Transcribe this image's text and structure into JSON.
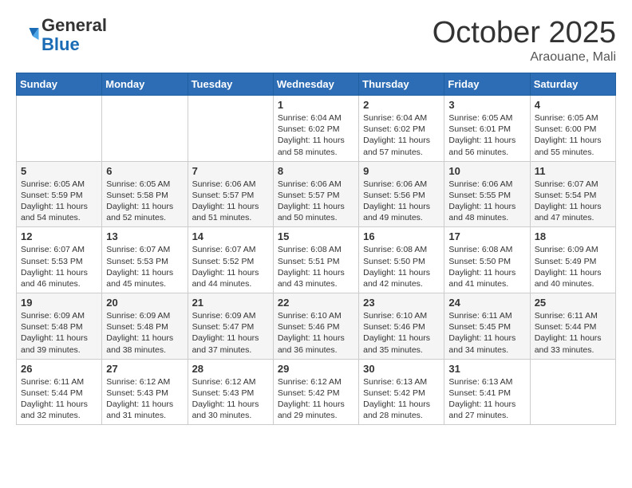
{
  "header": {
    "logo_general": "General",
    "logo_blue": "Blue",
    "month": "October 2025",
    "location": "Araouane, Mali"
  },
  "weekdays": [
    "Sunday",
    "Monday",
    "Tuesday",
    "Wednesday",
    "Thursday",
    "Friday",
    "Saturday"
  ],
  "weeks": [
    [
      {
        "day": "",
        "content": ""
      },
      {
        "day": "",
        "content": ""
      },
      {
        "day": "",
        "content": ""
      },
      {
        "day": "1",
        "content": "Sunrise: 6:04 AM\nSunset: 6:02 PM\nDaylight: 11 hours\nand 58 minutes."
      },
      {
        "day": "2",
        "content": "Sunrise: 6:04 AM\nSunset: 6:02 PM\nDaylight: 11 hours\nand 57 minutes."
      },
      {
        "day": "3",
        "content": "Sunrise: 6:05 AM\nSunset: 6:01 PM\nDaylight: 11 hours\nand 56 minutes."
      },
      {
        "day": "4",
        "content": "Sunrise: 6:05 AM\nSunset: 6:00 PM\nDaylight: 11 hours\nand 55 minutes."
      }
    ],
    [
      {
        "day": "5",
        "content": "Sunrise: 6:05 AM\nSunset: 5:59 PM\nDaylight: 11 hours\nand 54 minutes."
      },
      {
        "day": "6",
        "content": "Sunrise: 6:05 AM\nSunset: 5:58 PM\nDaylight: 11 hours\nand 52 minutes."
      },
      {
        "day": "7",
        "content": "Sunrise: 6:06 AM\nSunset: 5:57 PM\nDaylight: 11 hours\nand 51 minutes."
      },
      {
        "day": "8",
        "content": "Sunrise: 6:06 AM\nSunset: 5:57 PM\nDaylight: 11 hours\nand 50 minutes."
      },
      {
        "day": "9",
        "content": "Sunrise: 6:06 AM\nSunset: 5:56 PM\nDaylight: 11 hours\nand 49 minutes."
      },
      {
        "day": "10",
        "content": "Sunrise: 6:06 AM\nSunset: 5:55 PM\nDaylight: 11 hours\nand 48 minutes."
      },
      {
        "day": "11",
        "content": "Sunrise: 6:07 AM\nSunset: 5:54 PM\nDaylight: 11 hours\nand 47 minutes."
      }
    ],
    [
      {
        "day": "12",
        "content": "Sunrise: 6:07 AM\nSunset: 5:53 PM\nDaylight: 11 hours\nand 46 minutes."
      },
      {
        "day": "13",
        "content": "Sunrise: 6:07 AM\nSunset: 5:53 PM\nDaylight: 11 hours\nand 45 minutes."
      },
      {
        "day": "14",
        "content": "Sunrise: 6:07 AM\nSunset: 5:52 PM\nDaylight: 11 hours\nand 44 minutes."
      },
      {
        "day": "15",
        "content": "Sunrise: 6:08 AM\nSunset: 5:51 PM\nDaylight: 11 hours\nand 43 minutes."
      },
      {
        "day": "16",
        "content": "Sunrise: 6:08 AM\nSunset: 5:50 PM\nDaylight: 11 hours\nand 42 minutes."
      },
      {
        "day": "17",
        "content": "Sunrise: 6:08 AM\nSunset: 5:50 PM\nDaylight: 11 hours\nand 41 minutes."
      },
      {
        "day": "18",
        "content": "Sunrise: 6:09 AM\nSunset: 5:49 PM\nDaylight: 11 hours\nand 40 minutes."
      }
    ],
    [
      {
        "day": "19",
        "content": "Sunrise: 6:09 AM\nSunset: 5:48 PM\nDaylight: 11 hours\nand 39 minutes."
      },
      {
        "day": "20",
        "content": "Sunrise: 6:09 AM\nSunset: 5:48 PM\nDaylight: 11 hours\nand 38 minutes."
      },
      {
        "day": "21",
        "content": "Sunrise: 6:09 AM\nSunset: 5:47 PM\nDaylight: 11 hours\nand 37 minutes."
      },
      {
        "day": "22",
        "content": "Sunrise: 6:10 AM\nSunset: 5:46 PM\nDaylight: 11 hours\nand 36 minutes."
      },
      {
        "day": "23",
        "content": "Sunrise: 6:10 AM\nSunset: 5:46 PM\nDaylight: 11 hours\nand 35 minutes."
      },
      {
        "day": "24",
        "content": "Sunrise: 6:11 AM\nSunset: 5:45 PM\nDaylight: 11 hours\nand 34 minutes."
      },
      {
        "day": "25",
        "content": "Sunrise: 6:11 AM\nSunset: 5:44 PM\nDaylight: 11 hours\nand 33 minutes."
      }
    ],
    [
      {
        "day": "26",
        "content": "Sunrise: 6:11 AM\nSunset: 5:44 PM\nDaylight: 11 hours\nand 32 minutes."
      },
      {
        "day": "27",
        "content": "Sunrise: 6:12 AM\nSunset: 5:43 PM\nDaylight: 11 hours\nand 31 minutes."
      },
      {
        "day": "28",
        "content": "Sunrise: 6:12 AM\nSunset: 5:43 PM\nDaylight: 11 hours\nand 30 minutes."
      },
      {
        "day": "29",
        "content": "Sunrise: 6:12 AM\nSunset: 5:42 PM\nDaylight: 11 hours\nand 29 minutes."
      },
      {
        "day": "30",
        "content": "Sunrise: 6:13 AM\nSunset: 5:42 PM\nDaylight: 11 hours\nand 28 minutes."
      },
      {
        "day": "31",
        "content": "Sunrise: 6:13 AM\nSunset: 5:41 PM\nDaylight: 11 hours\nand 27 minutes."
      },
      {
        "day": "",
        "content": ""
      }
    ]
  ]
}
